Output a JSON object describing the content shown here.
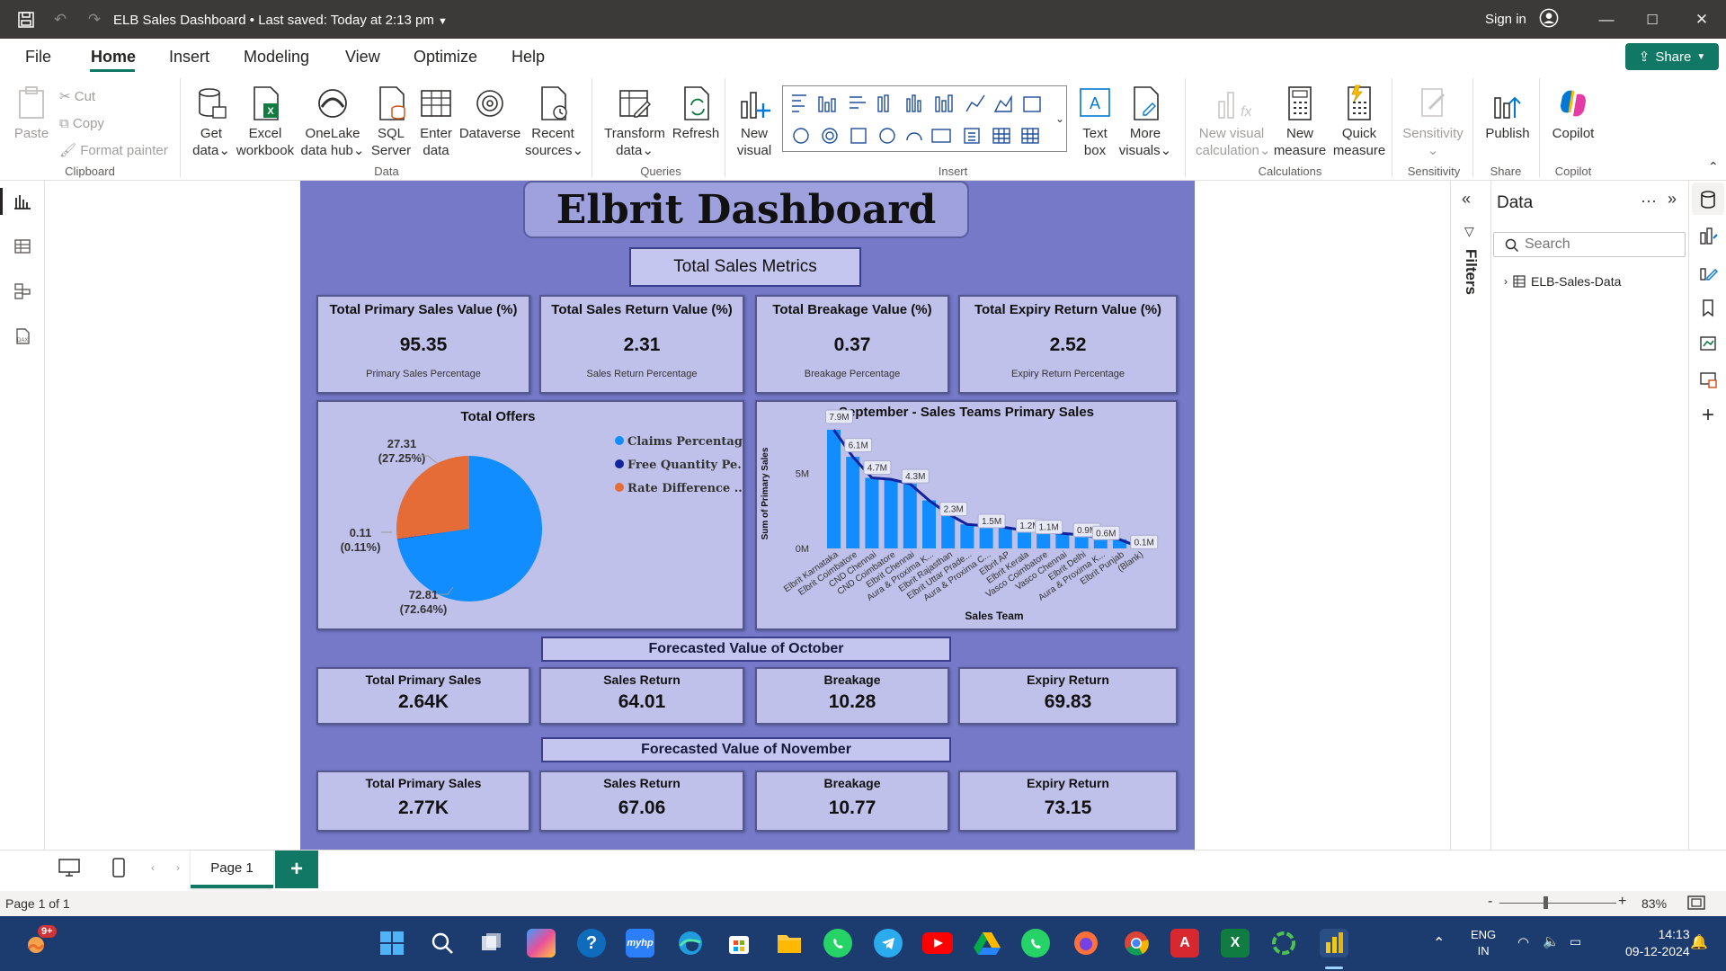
{
  "titlebar": {
    "title": "ELB Sales Dashboard",
    "saved": "Last saved: Today at 2:13 pm",
    "sign_in": "Sign in"
  },
  "menu": {
    "items": [
      "File",
      "Home",
      "Insert",
      "Modeling",
      "View",
      "Optimize",
      "Help"
    ],
    "share": "Share"
  },
  "ribbon": {
    "clipboard": {
      "paste": "Paste",
      "cut": "Cut",
      "copy": "Copy",
      "format_painter": "Format painter",
      "group": "Clipboard"
    },
    "data": {
      "get_data": [
        "Get",
        "data"
      ],
      "excel": [
        "Excel",
        "workbook"
      ],
      "onelake": [
        "OneLake",
        "data hub"
      ],
      "sql": [
        "SQL",
        "Server"
      ],
      "enter": [
        "Enter",
        "data"
      ],
      "dataverse": [
        "Dataverse",
        ""
      ],
      "recent": [
        "Recent",
        "sources"
      ],
      "group": "Data"
    },
    "queries": {
      "transform": [
        "Transform",
        "data"
      ],
      "refresh": [
        "Refresh",
        ""
      ],
      "group": "Queries"
    },
    "insert": {
      "new_visual": [
        "New",
        "visual"
      ],
      "text_box": [
        "Text",
        "box"
      ],
      "more_visuals": [
        "More",
        "visuals"
      ],
      "group": "Insert"
    },
    "calculations": {
      "new_visual_calc": [
        "New visual",
        "calculation"
      ],
      "new_measure": [
        "New",
        "measure"
      ],
      "quick_measure": [
        "Quick",
        "measure"
      ],
      "group": "Calculations"
    },
    "sensitivity": {
      "label": "Sensitivity",
      "group": "Sensitivity"
    },
    "share": {
      "publish": "Publish",
      "group": "Share"
    },
    "copilot": {
      "label": "Copilot",
      "group": "Copilot"
    }
  },
  "report": {
    "title": "Elbrit Dashboard",
    "metrics_header": "Total Sales Metrics",
    "metric_cards": [
      {
        "title": "Total Primary Sales Value (%)",
        "value": "95.35",
        "sub": "Primary Sales Percentage"
      },
      {
        "title": "Total Sales Return Value (%)",
        "value": "2.31",
        "sub": "Sales Return Percentage"
      },
      {
        "title": "Total Breakage Value (%)",
        "value": "0.37",
        "sub": "Breakage Percentage"
      },
      {
        "title": "Total Expiry Return Value (%)",
        "value": "2.52",
        "sub": "Expiry Return Percentage"
      }
    ],
    "pie_title": "Total Offers",
    "pie_labels": [
      {
        "value": "72.81",
        "pct": "(72.64%)"
      },
      {
        "value": "27.31",
        "pct": "(27.25%)"
      },
      {
        "value": "0.11",
        "pct": "(0.11%)"
      }
    ],
    "bar_title": "September - Sales Teams Primary Sales",
    "bar_ylabel": "Sum of Primary Sales",
    "bar_xlabel": "Sales Team",
    "october_header": "Forecasted Value of October",
    "october_cards": [
      {
        "title": "Total Primary Sales",
        "value": "2.64K"
      },
      {
        "title": "Sales Return",
        "value": "64.01"
      },
      {
        "title": "Breakage",
        "value": "10.28"
      },
      {
        "title": "Expiry Return",
        "value": "69.83"
      }
    ],
    "november_header": "Forecasted Value of November",
    "november_cards": [
      {
        "title": "Total Primary Sales",
        "value": "2.77K"
      },
      {
        "title": "Sales Return",
        "value": "67.06"
      },
      {
        "title": "Breakage",
        "value": "10.77"
      },
      {
        "title": "Expiry Return",
        "value": "73.15"
      }
    ]
  },
  "chart_data": [
    {
      "type": "pie",
      "title": "Total Offers",
      "legend": [
        "Claims Percentage",
        "Free Quantity Pe...",
        "Rate Difference ..."
      ],
      "values": [
        72.81,
        0.11,
        27.31
      ],
      "colors": [
        "#118dff",
        "#12239e",
        "#e66c37"
      ]
    },
    {
      "type": "bar",
      "title": "September - Sales Teams Primary Sales",
      "xlabel": "Sales Team",
      "ylabel": "Sum of Primary Sales",
      "categories": [
        "Elbrit Karnataka",
        "Elbrit Coimbatore",
        "CND Chennai",
        "CND Coimbatore",
        "Elbrit Chennai",
        "Aura & Proxima K...",
        "Elbrit Rajasthan",
        "Elbrit Uttar Prade...",
        "Aura & Proxima C...",
        "Elbrit AP",
        "Elbrit Kerala",
        "Vasco Coimbatore",
        "Vasco Chennai",
        "Elbrit Delhi",
        "Aura & Proxima K...",
        "Elbrit Punjab",
        "(Blank)"
      ],
      "values": [
        7.9,
        6.1,
        4.7,
        4.6,
        4.3,
        3.2,
        2.3,
        1.6,
        1.5,
        1.4,
        1.2,
        1.1,
        1.0,
        0.9,
        0.7,
        0.6,
        0.1
      ],
      "labels": {
        "0": "7.9M",
        "1": "6.1M",
        "2": "4.7M",
        "4": "4.3M",
        "6": "2.3M",
        "8": "1.5M",
        "10": "1.2M",
        "11": "1.1M",
        "13": "0.9M",
        "14": "0.6M",
        "16": "0.1M"
      },
      "yticks": [
        "0M",
        "5M"
      ],
      "ylim": [
        0,
        8.5
      ],
      "bar_color": "#118dff",
      "line_color": "#12239e"
    }
  ],
  "filters": {
    "label": "Filters"
  },
  "datapane": {
    "title": "Data",
    "search_placeholder": "Search",
    "table": "ELB-Sales-Data"
  },
  "pagetabs": {
    "page": "Page 1",
    "add": "+"
  },
  "status": {
    "page_info": "Page 1 of 1",
    "zoom": "83%"
  },
  "taskbar": {
    "badge": "9+",
    "lang1": "ENG",
    "lang2": "IN",
    "time": "14:13",
    "date": "09-12-2024"
  }
}
